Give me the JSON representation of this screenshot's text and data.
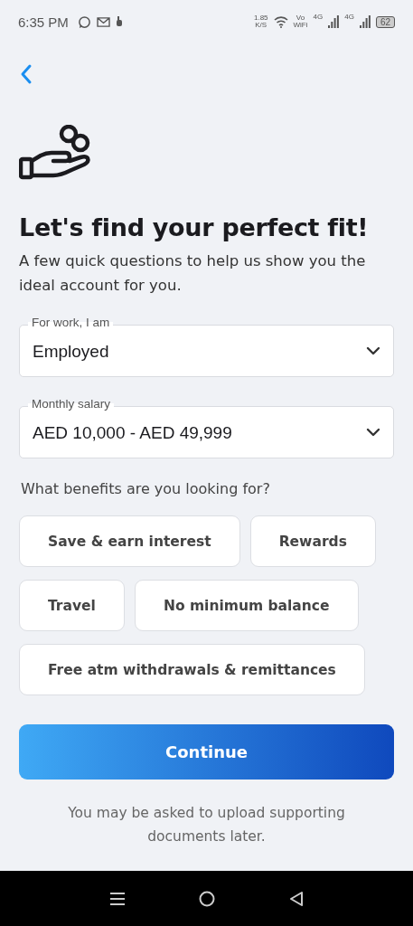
{
  "status_bar": {
    "time": "6:35 PM",
    "speed": "1.85",
    "speed_unit": "K/S",
    "vo": "Vo",
    "wifi_label": "WiFi",
    "networks": [
      "4G",
      "4G"
    ],
    "battery": "62"
  },
  "title": "Let's find your perfect fit!",
  "subtitle": "A few quick questions to help us show you the ideal account for you.",
  "fields": [
    {
      "label": "For work, I am",
      "value": "Employed"
    },
    {
      "label": "Monthly salary",
      "value": "AED 10,000 - AED 49,999"
    }
  ],
  "question": "What benefits are you looking for?",
  "benefit_rows": [
    [
      {
        "label": "Save & earn interest",
        "selected": false
      },
      {
        "label": "Rewards",
        "selected": false
      }
    ],
    [
      {
        "label": "Travel",
        "selected": false
      },
      {
        "label": "No minimum balance",
        "selected": false
      }
    ],
    [
      {
        "label": "Free atm withdrawals & remittances",
        "selected": false
      }
    ]
  ],
  "continue_button": "Continue",
  "note": "You may be asked to upload supporting documents later."
}
